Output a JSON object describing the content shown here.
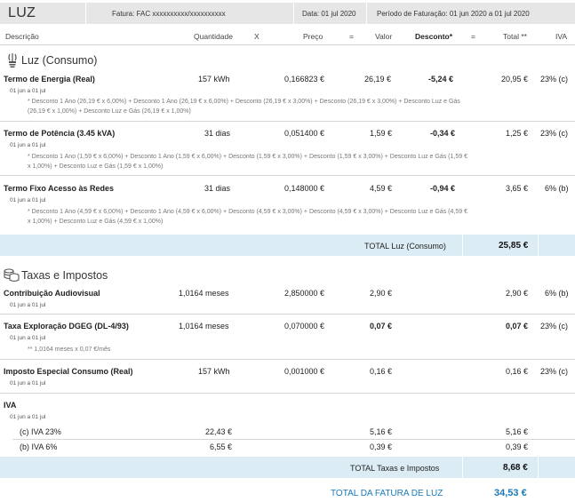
{
  "header": {
    "title": "LUZ",
    "fatura": "Fatura: FAC xxxxxxxxxx/xxxxxxxxxx",
    "data": "Data: 01 jul 2020",
    "periodo": "Período de Faturação:  01 jun 2020 a 01 jul 2020"
  },
  "columns": {
    "descricao": "Descrição",
    "quantidade": "Quantidade",
    "x": "X",
    "preco": "Preço",
    "eq1": "=",
    "valor": "Valor",
    "desconto": "Desconto*",
    "eq2": "=",
    "total": "Total **",
    "iva": "IVA"
  },
  "luz": {
    "title": "Luz (Consumo)",
    "rows": [
      {
        "label": "Termo de Energia (Real)",
        "period": "01 jun a 01 jul",
        "quantidade": "157 kWh",
        "preco": "0,166823 €",
        "valor": "26,19 €",
        "desconto": "-5,24 €",
        "total": "20,95 €",
        "iva": "23% (c)",
        "note1": "* Desconto 1 Ano (26,19 € x 6,00%) + Desconto 1 Ano (26,19 € x 6,00%) + Desconto (26,19 € x 3,00%) + Desconto (26,19 € x 3,00%) + Desconto Luz e Gás",
        "note2": "(26,19 € x 1,00%) + Desconto Luz e Gás (26,19 € x 1,00%)"
      },
      {
        "label": "Termo de Potência (3.45 kVA)",
        "period": "01 jun a 01 jul",
        "quantidade": "31 dias",
        "preco": "0,051400 €",
        "valor": "1,59 €",
        "desconto": "-0,34 €",
        "total": "1,25 €",
        "iva": "23% (c)",
        "note1": "* Desconto 1 Ano (1,59 € x 6,00%) + Desconto 1 Ano (1,59 € x 6,00%) + Desconto (1,59 € x 3,00%) + Desconto (1,59 € x 3,00%) + Desconto Luz e Gás (1,59 €",
        "note2": "x 1,00%) + Desconto Luz e Gás (1,59 € x 1,00%)"
      },
      {
        "label": "Termo Fixo Acesso às Redes",
        "period": "01 jun a 01 jul",
        "quantidade": "31 dias",
        "preco": "0,148000 €",
        "valor": "4,59 €",
        "desconto": "-0,94 €",
        "total": "3,65 €",
        "iva": "6% (b)",
        "note1": "* Desconto 1 Ano (4,59 € x 6,00%) + Desconto 1 Ano (4,59 € x 6,00%) + Desconto (4,59 € x 3,00%) + Desconto (4,59 € x 3,00%) + Desconto Luz e Gás (4,59 €",
        "note2": "x 1,00%) + Desconto Luz e Gás (4,59 € x 1,00%)"
      }
    ],
    "total_label": "TOTAL Luz (Consumo)",
    "total_value": "25,85 €"
  },
  "taxas": {
    "title": "Taxas e Impostos",
    "rows": [
      {
        "label": "Contribuição Audiovisual",
        "period": "01 jun a 01 jul",
        "quantidade": "1,0164 meses",
        "preco": "2,850000 €",
        "valor": "2,90 €",
        "total": "2,90 €",
        "iva": "6% (b)"
      },
      {
        "label": "Taxa Exploração DGEG (DL-4/93)",
        "period": "01 jun a 01 jul",
        "quantidade": "1,0164 meses",
        "preco": "0,070000 €",
        "valor": "0,07 €",
        "total": "0,07 €",
        "iva": "23% (c)",
        "note": "** 1,0164 meses x 0,07 €/mês"
      },
      {
        "label": "Imposto Especial Consumo (Real)",
        "period": "01 jun a 01 jul",
        "quantidade": "157 kWh",
        "preco": "0,001000 €",
        "valor": "0,16 €",
        "total": "0,16 €",
        "iva": "23% (c)"
      }
    ],
    "iva": {
      "label": "IVA",
      "period": "01 jun a 01 jul",
      "lines": [
        {
          "label": "(c) IVA 23%",
          "base": "22,43 €",
          "valor": "5,16 €",
          "total": "5,16 €"
        },
        {
          "label": "(b) IVA 6%",
          "base": "6,55 €",
          "valor": "0,39 €",
          "total": "0,39 €"
        }
      ]
    },
    "total_label": "TOTAL Taxas e Impostos",
    "total_value": "8,68 €"
  },
  "grand_total": {
    "label": "TOTAL DA FATURA DE LUZ",
    "value": "34,53 €"
  }
}
